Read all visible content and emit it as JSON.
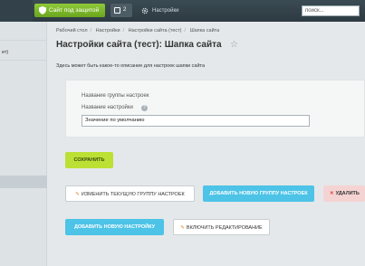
{
  "topbar": {
    "protect_label": "Сайт под защитой",
    "notifications_count": "2",
    "settings_label": "Настройки",
    "search_placeholder": "поиск..."
  },
  "sidebar": {
    "items": [
      "ет)"
    ]
  },
  "breadcrumb": [
    "Рабочий стол",
    "Настройки",
    "Настройки сайта (тест)",
    "Шапка сайта"
  ],
  "page": {
    "title": "Настройки сайта (тест): Шапка сайта",
    "description": "Здесь может быть какое-то описание для настроек шапки сайта"
  },
  "form": {
    "group_label": "Название группы настроек",
    "setting_label": "Название настройки",
    "value": "Значение по умолчанию",
    "save_label": "СОХРАНИТЬ"
  },
  "actions": {
    "edit_group": "ИЗМЕНИТЬ ТЕКУЩУЮ ГРУППУ НАСТРОЕК",
    "add_group": "ДОБАВИТЬ НОВУЮ ГРУППУ НАСТРОЕК",
    "delete": "УДАЛИТЬ",
    "add_setting": "ДОБАВИТЬ НОВУЮ НАСТРОЙКУ",
    "enable_edit": "ВКЛЮЧИТЬ РЕДАКТИРОВАНИЕ"
  }
}
